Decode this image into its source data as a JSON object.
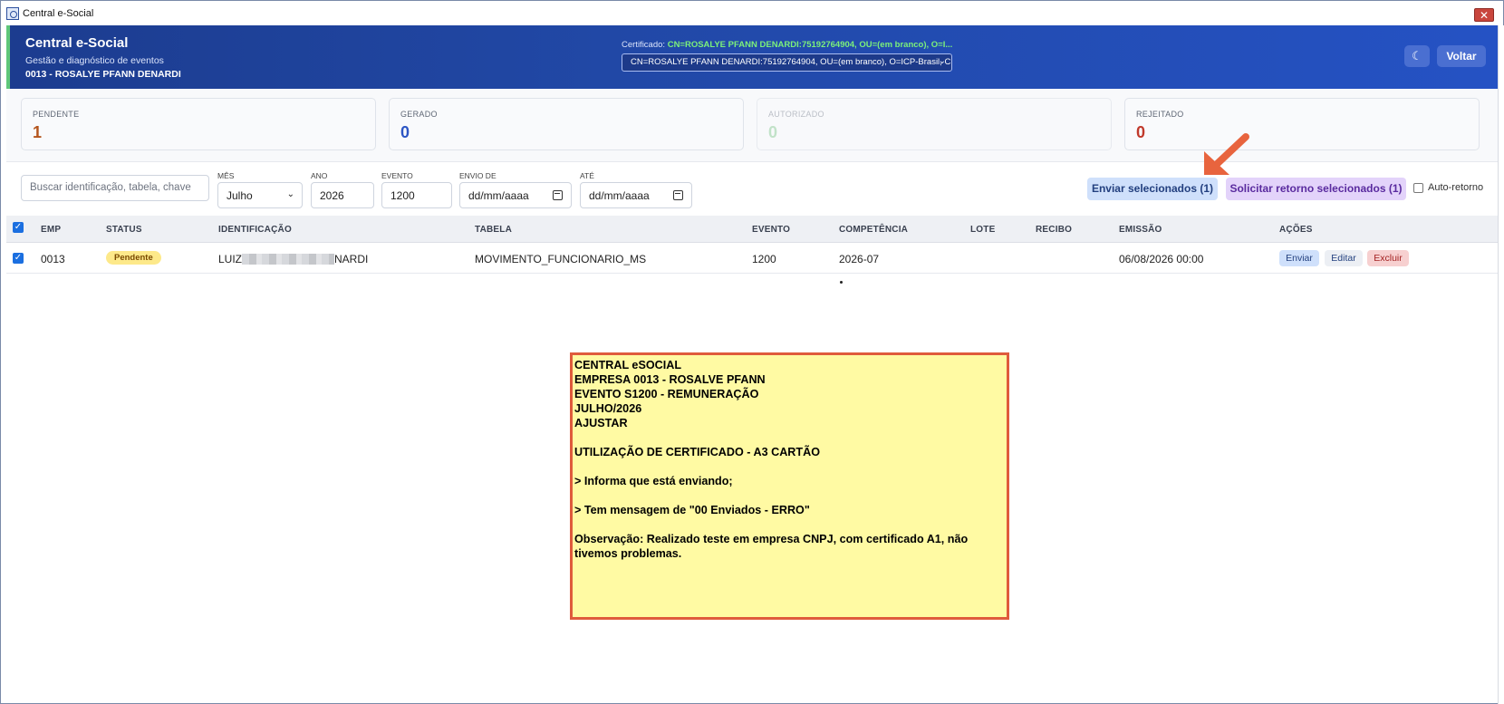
{
  "window": {
    "title": "Central e-Social",
    "close_label": "✕"
  },
  "header": {
    "title": "Central e-Social",
    "subtitle": "Gestão e diagnóstico de eventos",
    "company": "0013 - ROSALYE PFANN DENARDI",
    "certificate_label": "Certificado:",
    "certificate_value": "CN=ROSALYE PFANN DENARDI:75192764904, OU=(em branco), O=I...",
    "certificate_select": "CN=ROSALYE PFANN DENARDI:75192764904, OU=(em branco), O=ICP-Brasil, C",
    "theme_icon": "☾",
    "back_label": "Voltar"
  },
  "stats": [
    {
      "label": "PENDENTE",
      "value": "1",
      "color": "#b4541c"
    },
    {
      "label": "GERADO",
      "value": "0",
      "color": "#2c55c4"
    },
    {
      "label": "AUTORIZADO",
      "value": "0",
      "color": "#a5d6ad"
    },
    {
      "label": "REJEITADO",
      "value": "0",
      "color": "#c0392b"
    }
  ],
  "filters": {
    "search_placeholder": "Buscar identificação, tabela, chave",
    "month_label": "MÊS",
    "month_value": "Julho",
    "year_label": "ANO",
    "year_value": "2026",
    "event_label": "EVENTO",
    "event_value": "1200",
    "from_label": "ENVIO DE",
    "from_placeholder": "dd/mm/aaaa",
    "to_label": "ATÉ",
    "to_placeholder": "dd/mm/aaaa",
    "send_selected_label": "Enviar selecionados (1)",
    "request_return_label": "Solicitar retorno selecionados (1)",
    "auto_return_label": "Auto-retorno"
  },
  "table": {
    "columns": [
      "EMP",
      "STATUS",
      "IDENTIFICAÇÃO",
      "TABELA",
      "EVENTO",
      "COMPETÊNCIA",
      "LOTE",
      "RECIBO",
      "EMISSÃO",
      "AÇÕES"
    ],
    "rows": [
      {
        "emp": "0013",
        "status": "Pendente",
        "id_prefix": "LUIZ",
        "id_suffix": "NARDI",
        "table": "MOVIMENTO_FUNCIONARIO_MS",
        "event": "1200",
        "competence": "2026-07",
        "lote": "",
        "recibo": "",
        "emission": "06/08/2026 00:00",
        "actions": {
          "send": "Enviar",
          "edit": "Editar",
          "delete": "Excluir"
        }
      }
    ]
  },
  "note": {
    "lines": [
      "CENTRAL eSOCIAL",
      "EMPRESA 0013 - ROSALVE PFANN",
      "EVENTO S1200 - REMUNERAÇÃO",
      "JULHO/2026",
      "AJUSTAR",
      "",
      "UTILIZAÇÃO DE CERTIFICADO - A3 CARTÃO",
      "",
      "> Informa que está enviando;",
      "",
      "> Tem mensagem de \"00 Enviados - ERRO\"",
      "",
      "Observação: Realizado teste em empresa CNPJ, com certificado A1, não",
      "tivemos problemas."
    ]
  },
  "colors": {
    "header_bg": "#2148a6",
    "accent_green": "#5fc77a",
    "note_bg": "#fffaa3",
    "note_border": "#df5b3c",
    "arrow": "#e8643e"
  }
}
